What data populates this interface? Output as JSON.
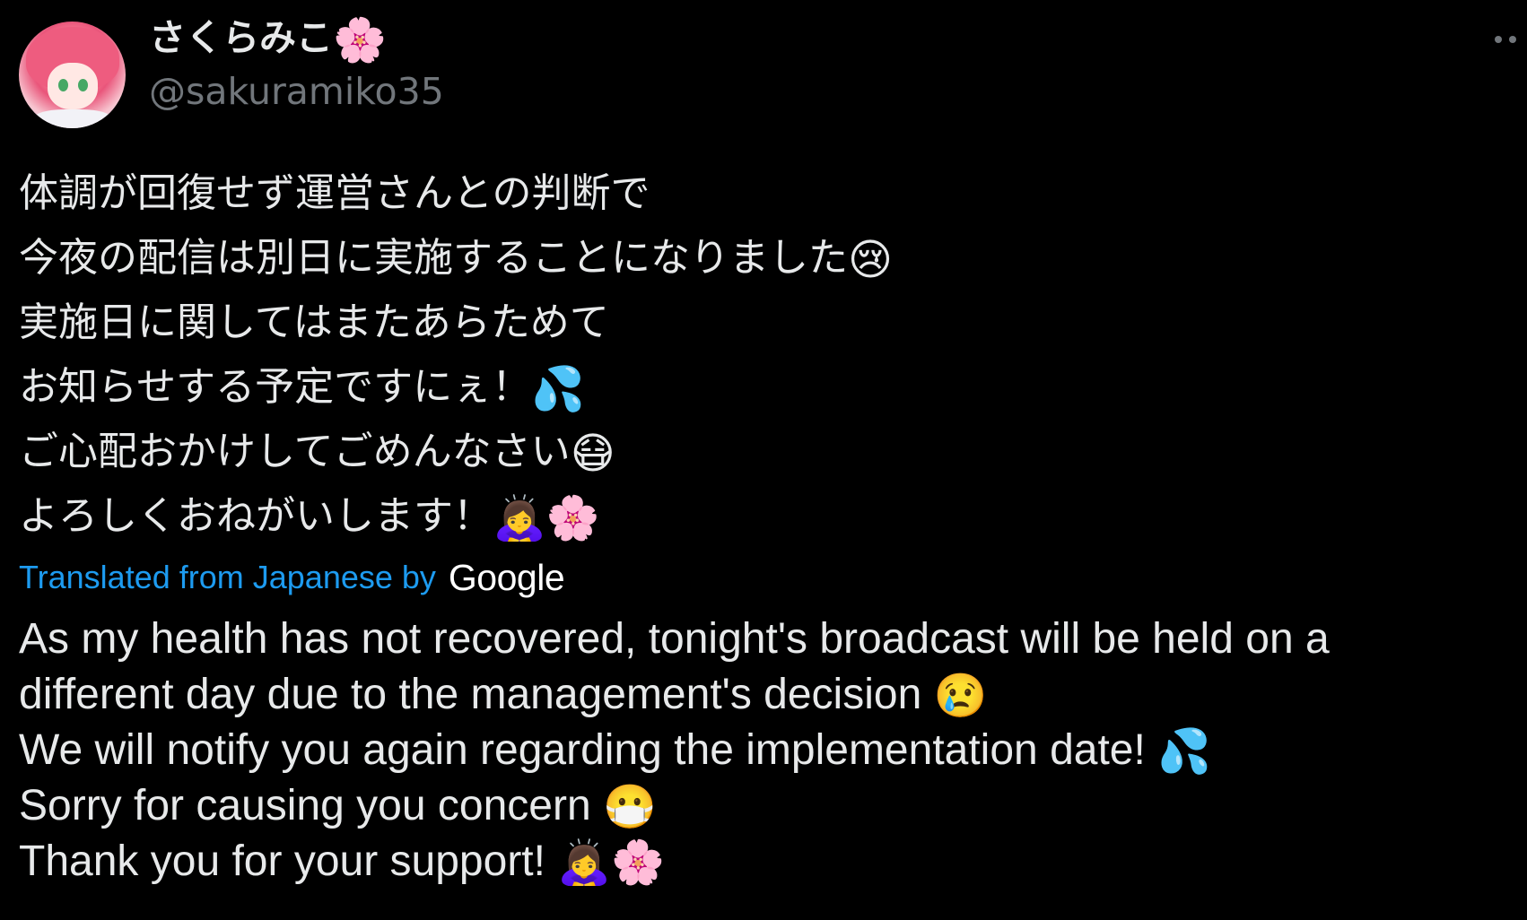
{
  "author": {
    "display_name": "さくらみこ",
    "name_emoji": "🌸",
    "handle": "@sakuramiko35"
  },
  "menu": {
    "more_icon": "more-dots-icon"
  },
  "japanese_lines": [
    {
      "text": "体調が回復せず運営さんとの判断で",
      "emoji": ""
    },
    {
      "text": "今夜の配信は別日に実施することになりました",
      "emoji": "😢"
    },
    {
      "text": "実施日に関してはまたあらためて",
      "emoji": ""
    },
    {
      "text": "お知らせする予定ですにぇ！",
      "emoji": "💦"
    },
    {
      "text": "ご心配おかけしてごめんなさい",
      "emoji": "😷"
    },
    {
      "text": "よろしくおねがいします！",
      "emoji": "🙇‍♀️🌸"
    }
  ],
  "translation": {
    "label": "Translated from Japanese by",
    "provider": "Google",
    "accent_color": "#1d9bf0"
  },
  "english_lines": [
    {
      "text": "As my health has not recovered, tonight's broadcast will be held on a",
      "emoji": ""
    },
    {
      "text": "different day due to the management's decision ",
      "emoji": "😢"
    },
    {
      "text": "We will notify you again regarding the implementation date! ",
      "emoji": "💦"
    },
    {
      "text": "Sorry for causing you concern ",
      "emoji": "😷"
    },
    {
      "text": "Thank you for your support! ",
      "emoji": "🙇‍♀️🌸"
    }
  ]
}
